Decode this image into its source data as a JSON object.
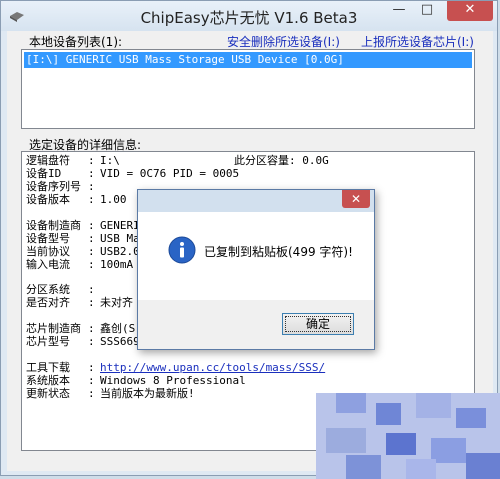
{
  "window": {
    "title": "ChipEasy芯片无忧 V1.6 Beta3",
    "minimize_glyph": "—",
    "maximize_glyph": "□",
    "close_glyph": "✕"
  },
  "device_list": {
    "label": "本地设备列表(1):",
    "remove_link": "安全删除所选设备(I:)",
    "report_link": "上报所选设备芯片(I:)",
    "items": [
      "[I:\\] GENERIC USB Mass Storage USB Device [0.0G]"
    ]
  },
  "details": {
    "label": "选定设备的详细信息:",
    "rows": [
      {
        "key": "逻辑盘符",
        "value": "I:\\"
      },
      {
        "key": "设备ID",
        "value": "VID = 0C76      PID = 0005"
      },
      {
        "key": "设备序列号",
        "value": ""
      },
      {
        "key": "设备版本",
        "value": "1.00"
      },
      {
        "key": "设备制造商",
        "value": "GENERI"
      },
      {
        "key": "设备型号",
        "value": "USB Ma"
      },
      {
        "key": "当前协议",
        "value": "USB2.0"
      },
      {
        "key": "输入电流",
        "value": "100mA"
      },
      {
        "key": "分区系统",
        "value": ""
      },
      {
        "key": "是否对齐",
        "value": "未对齐"
      },
      {
        "key": "芯片制造商",
        "value": "鑫创(S"
      },
      {
        "key": "芯片型号",
        "value": "SSS669"
      },
      {
        "key": "工具下载",
        "value": "http://www.upan.cc/tools/mass/SSS/"
      },
      {
        "key": "系统版本",
        "value": "Windows 8 Professional"
      },
      {
        "key": "更新状态",
        "value": "当前版本为最新版!"
      }
    ],
    "capacity_label": "此分区容量:",
    "capacity_value": "0.0G",
    "colon": ":"
  },
  "dialog": {
    "close_glyph": "✕",
    "message": "已复制到粘贴板(499 字符)!",
    "ok_label": "确定",
    "icon": "info-icon"
  },
  "colors": {
    "link": "#1a2fbd",
    "selection": "#3399ff",
    "close": "#c75050"
  }
}
